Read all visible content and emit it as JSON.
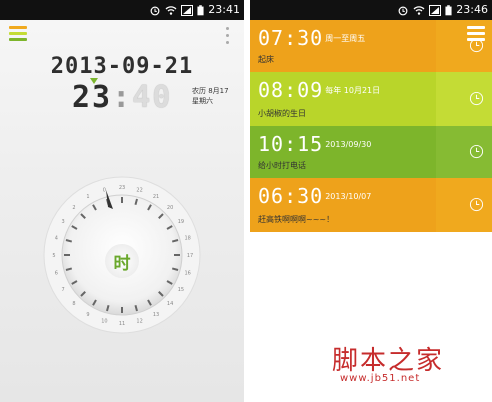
{
  "left": {
    "status_time": "23:41",
    "date": "2013-09-21",
    "time_hour": "23",
    "time_minute": "40",
    "lunar_date": "农历 8月17",
    "weekday": "星期六",
    "dial_label": "时",
    "dial_numbers": [
      "23",
      "22",
      "21",
      "20",
      "19",
      "18",
      "17",
      "16",
      "15",
      "14",
      "13",
      "12",
      "11",
      "10",
      "9",
      "8",
      "7",
      "6",
      "5",
      "4",
      "3",
      "2",
      "1",
      "0"
    ],
    "accent": "#7bb52e"
  },
  "right": {
    "status_time": "23:46",
    "alarms": [
      {
        "time": "07:30",
        "repeat": "周一至周五",
        "label": "起床",
        "color": "#eea21b",
        "side_color": "#f0a91e"
      },
      {
        "time": "08:09",
        "repeat": "每年 10月21日",
        "label": "小胡椒的生日",
        "color": "#b9d52a",
        "side_color": "#c4dc35"
      },
      {
        "time": "10:15",
        "repeat": "2013/09/30",
        "label": "给小时打电话",
        "color": "#7db52b",
        "side_color": "#86bb33"
      },
      {
        "time": "06:30",
        "repeat": "2013/10/07",
        "label": "赶高铁啊啊啊~~~！",
        "color": "#eea21b",
        "side_color": "#f0a91e"
      }
    ]
  },
  "watermark": {
    "title": "脚本之家",
    "url": "www.jb51.net"
  }
}
